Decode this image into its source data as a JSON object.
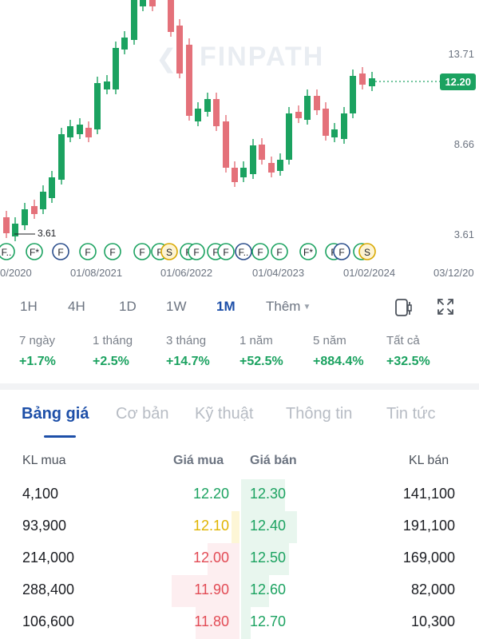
{
  "chart": {
    "watermark": "FINPATH",
    "watermark_icon": "chevron-left-icon",
    "y_ticks": [
      "13.71",
      "12.20",
      "8.66",
      "3.61"
    ],
    "last_price": "12.20",
    "low_label": "3.61",
    "x_ticks": [
      "0/2020",
      "01/08/2021",
      "01/06/2022",
      "01/04/2023",
      "01/02/2024",
      "03/12/20"
    ],
    "up_color": "#1ba260",
    "down_color": "#e4717a",
    "markers": [
      {
        "label": "F..",
        "type": "F"
      },
      {
        "label": "F*",
        "type": "F"
      },
      {
        "label": "F",
        "type": "F"
      },
      {
        "label": "F",
        "type": "F"
      },
      {
        "label": "F",
        "type": "F"
      },
      {
        "label": "F",
        "type": "F"
      },
      {
        "label": "F",
        "type": "F"
      },
      {
        "label": "S",
        "type": "S"
      },
      {
        "label": "F",
        "type": "F"
      },
      {
        "label": "F",
        "type": "F"
      },
      {
        "label": "F",
        "type": "F"
      },
      {
        "label": "F",
        "type": "F"
      },
      {
        "label": "F..",
        "type": "F"
      },
      {
        "label": "F",
        "type": "F"
      },
      {
        "label": "F",
        "type": "F"
      },
      {
        "label": "F*",
        "type": "F"
      },
      {
        "label": "F",
        "type": "F"
      },
      {
        "label": "F",
        "type": "F"
      },
      {
        "label": "F",
        "type": "F"
      },
      {
        "label": "S",
        "type": "S"
      },
      {
        "label": "F",
        "type": "F"
      },
      {
        "label": "F*",
        "type": "F"
      }
    ]
  },
  "intervals": [
    "1H",
    "4H",
    "1D",
    "1W",
    "1M"
  ],
  "active_interval": "1M",
  "more_label": "Thêm",
  "performance": [
    {
      "label": "7 ngày",
      "value": "+1.7%"
    },
    {
      "label": "1 tháng",
      "value": "+2.5%"
    },
    {
      "label": "3 tháng",
      "value": "+14.7%"
    },
    {
      "label": "1 năm",
      "value": "+52.5%"
    },
    {
      "label": "5 năm",
      "value": "+884.4%"
    },
    {
      "label": "Tất cả",
      "value": "+32.5%"
    }
  ],
  "tabs": [
    "Bảng giá",
    "Cơ bản",
    "Kỹ thuật",
    "Thông tin",
    "Tin tức"
  ],
  "order_book": {
    "headers": {
      "bid_vol": "KL mua",
      "bid_price": "Giá mua",
      "ask_price": "Giá bán",
      "ask_vol": "KL bán"
    },
    "rows": [
      {
        "bid_vol": "4,100",
        "bid_price": "12.20",
        "ask_price": "12.30",
        "ask_vol": "141,100",
        "bid_color": "#1ba260",
        "ask_color": "#1ba260"
      },
      {
        "bid_vol": "93,900",
        "bid_price": "12.10",
        "ask_price": "12.40",
        "ask_vol": "191,100",
        "bid_color": "#e0b400",
        "ask_color": "#1ba260"
      },
      {
        "bid_vol": "214,000",
        "bid_price": "12.00",
        "ask_price": "12.50",
        "ask_vol": "169,000",
        "bid_color": "#e24b55",
        "ask_color": "#1ba260"
      },
      {
        "bid_vol": "288,400",
        "bid_price": "11.90",
        "ask_price": "12.60",
        "ask_vol": "82,000",
        "bid_color": "#e24b55",
        "ask_color": "#1ba260"
      },
      {
        "bid_vol": "106,600",
        "bid_price": "11.80",
        "ask_price": "12.70",
        "ask_vol": "10,300",
        "bid_color": "#e24b55",
        "ask_color": "#1ba260"
      }
    ]
  }
}
